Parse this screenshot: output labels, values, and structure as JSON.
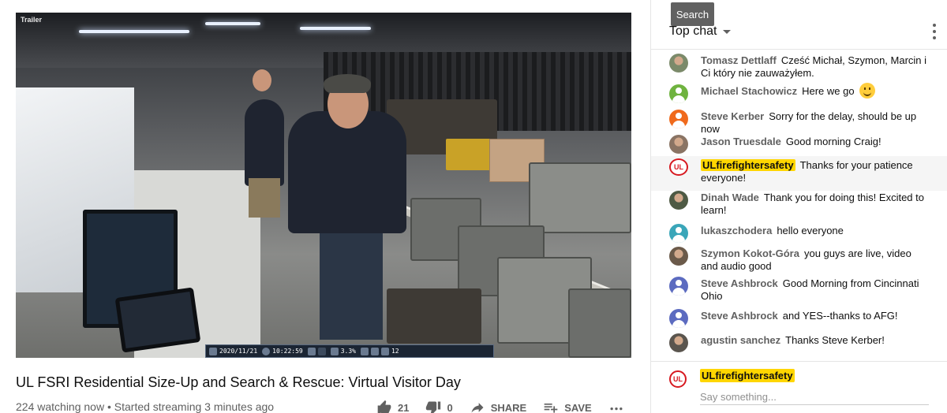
{
  "video": {
    "overlay_label": "Trailer",
    "osd": {
      "date": "2020/11/21",
      "time": "10:22:59",
      "percent": "3.3%",
      "count": "12"
    }
  },
  "title": "UL FSRI Residential Size-Up and Search & Rescue: Virtual Visitor Day",
  "meta": {
    "watching": "224 watching now",
    "started": "Started streaming 3 minutes ago",
    "separator": "•"
  },
  "actions": {
    "likes": "21",
    "dislikes": "0",
    "share": "SHARE",
    "save": "SAVE"
  },
  "chat": {
    "tooltip": "Search",
    "header": "Top chat",
    "messages": [
      {
        "author": "Tomasz Dettlaff",
        "text": "Cześć Michał, Szymon, Marcin i Ci który nie zauważyłem.",
        "avatar_color": "#7b8a6a",
        "avatar": "photo"
      },
      {
        "author": "Michael Stachowicz",
        "text": "Here we go",
        "avatar_color": "#6fb33f",
        "avatar": "generic",
        "emoji": "smile"
      },
      {
        "author": "Steve Kerber",
        "text": "Sorry for the delay, should be up now",
        "avatar_color": "#f06a1c",
        "avatar": "generic"
      },
      {
        "author": "Jason Truesdale",
        "text": "Good morning Craig!",
        "avatar_color": "#8a7464",
        "avatar": "photo"
      },
      {
        "author": "ULfirefightersafety",
        "text": "Thanks for your patience everyone!",
        "avatar": "ul",
        "owner": true
      },
      {
        "author": "Dinah Wade",
        "text": "Thank you for doing this! Excited to learn!",
        "avatar_color": "#4e5a44",
        "avatar": "photo"
      },
      {
        "author": "lukaszchodera",
        "text": "hello everyone",
        "avatar_color": "#3aa6b9",
        "avatar": "generic"
      },
      {
        "author": "Szymon Kokot-Góra",
        "text": "you guys are live, video and audio good",
        "avatar_color": "#6b5a4a",
        "avatar": "photo"
      },
      {
        "author": "Steve Ashbrock",
        "text": "Good Morning from Cincinnati Ohio",
        "avatar_color": "#5c6bc0",
        "avatar": "generic"
      },
      {
        "author": "Steve Ashbrock",
        "text": "and YES--thanks to AFG!",
        "avatar_color": "#5c6bc0",
        "avatar": "generic"
      },
      {
        "author": "agustin sanchez",
        "text": "Thanks Steve Kerber!",
        "avatar_color": "#5a554e",
        "avatar": "photo"
      }
    ],
    "input": {
      "owner": "ULfirefightersafety",
      "placeholder": "Say something...",
      "logo_text": "UL"
    }
  }
}
